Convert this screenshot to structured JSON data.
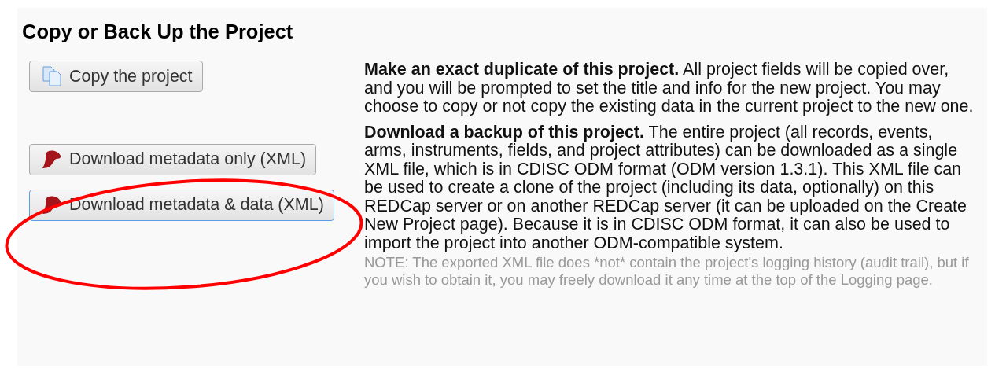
{
  "section": {
    "title": "Copy or Back Up the Project"
  },
  "rows": [
    {
      "buttons": [
        {
          "label": "Copy the project",
          "kind": "copy",
          "highlighted": false
        }
      ],
      "description": "**Make an exact duplicate of this project.** All project fields will be copied over, and you will be prompted to set the title and info for the new project. You may choose to copy or not copy the existing data in the current project to the new one."
    },
    {
      "buttons": [
        {
          "label": "Download metadata only (XML)",
          "kind": "download",
          "highlighted": false
        },
        {
          "label": "Download metadata & data (XML)",
          "kind": "download",
          "highlighted": true
        }
      ],
      "description": "**Download a backup of this project.** The entire project (all records, events, arms, instruments, fields, and project attributes) can be downloaded as a single XML file, which is in CDISC ODM format (ODM version 1.3.1). This XML file can be used to create a clone of the project (including its data, optionally) on this REDCap server or on another REDCap server (it can be uploaded on the Create New Project page). Because it is in CDISC ODM format, it can also be used to import the project into another ODM-compatible system.",
      "note": "NOTE: The exported XML file does *not* contain the project's logging history (audit trail), but if you wish to obtain it, you may freely download it any time at the top of the Logging page."
    }
  ],
  "annotation": {
    "kind": "ellipse",
    "color": "#ff0000"
  }
}
